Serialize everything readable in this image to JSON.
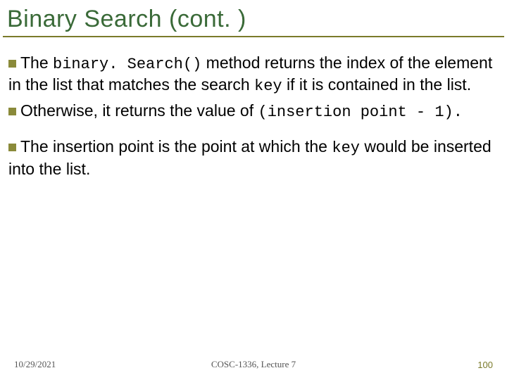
{
  "title": "Binary Search (cont. )",
  "bullets": [
    {
      "pre": "The ",
      "code1": "binary. Search()",
      "mid1": " method returns the index of the element in the list that matches the search ",
      "code2": "key",
      "post": " if it is contained in the list."
    },
    {
      "pre": "Otherwise, it returns the value of ",
      "code1": "(insertion point - 1).",
      "mid1": "",
      "code2": "",
      "post": ""
    },
    {
      "pre": "The insertion point is the point at which the ",
      "code1": "key",
      "mid1": " would be inserted into the list.",
      "code2": "",
      "post": ""
    }
  ],
  "footer": {
    "date": "10/29/2021",
    "course": "COSC-1336, Lecture 7",
    "page": "100"
  }
}
